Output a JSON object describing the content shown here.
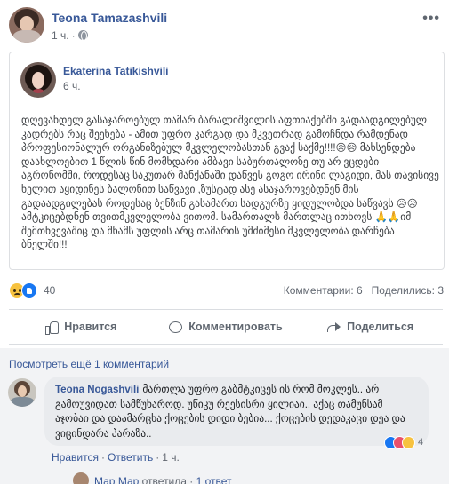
{
  "post": {
    "author": "Teona Tamazashvili",
    "time": "1 ч.",
    "shared": {
      "author": "Ekaterina Tatikishvili",
      "time": "6 ч.",
      "text": "დღევანდელ გასაჯაროებულ თამარ ბარალიშვილის აფთიაქებში გადაადგილებულ კადრებს რაც შეეხება - ამით უფრო კარგად და მკვეთრად გამოჩნდა რამდენად პროფესიონალურ ორგანიზებულ მკვლელობასთან გვაქ საქმე!!!!😥😥 მახსენდება დაახლოებით 1 წლის წინ მომხდარი ამბავი საბურთალოზე თუ არ ვცდები აგრონომში, როდესაც საკუთარ მანქანაში დაწვეს გოგო ირინი ლაგიდი, მას თავისივე ხელით აყიდინეს ბალონით საწვავი ,ზუსტად ასე ასაჯაროვებდნენ მის გადაადგილებას როდესაც ბენზინ გასამართ სადგურზე ყიდულობდა საწვავს 😥😥 ამტკიცებდნენ თვითმკვლელობა ვითომ. სამართალს მართლაც ითხოვს 🙏🙏იმ შემთხვევაშიც და მნამს უფლის არც თამარის უმძიმესი მკვლელობა დარჩება ბნელში!!!"
    },
    "reactions": {
      "count": "40"
    },
    "counts": {
      "comments": "Комментарии: 6",
      "shares": "Поделились: 3"
    },
    "actions": {
      "like": "Нравится",
      "comment": "Комментировать",
      "share": "Поделиться"
    }
  },
  "comments": {
    "view_more": "Посмотреть ещё 1 комментарий",
    "items": [
      {
        "author": "Teona Nogashvili",
        "text": "მართლა უფრო გაბმტკიცეს ის რომ მოკლეს.. არ გამოუვიდათ სამწუხაროდ. უწიკუ რეესისრი ყილიაი.. აქაც თამუნსამ აჯობაი და დაამარცხა ქოცების დიდი ბებია... ქოცების დედაკაცი დეა და ვიცინდარა პარაზა..",
        "reaction_count": "4",
        "like_label": "Нравится",
        "reply_label": "Ответить",
        "time": "1 ч."
      }
    ],
    "reply_preview": {
      "author": "Мар Мар",
      "action": "ответила",
      "count": "1 ответ"
    }
  }
}
